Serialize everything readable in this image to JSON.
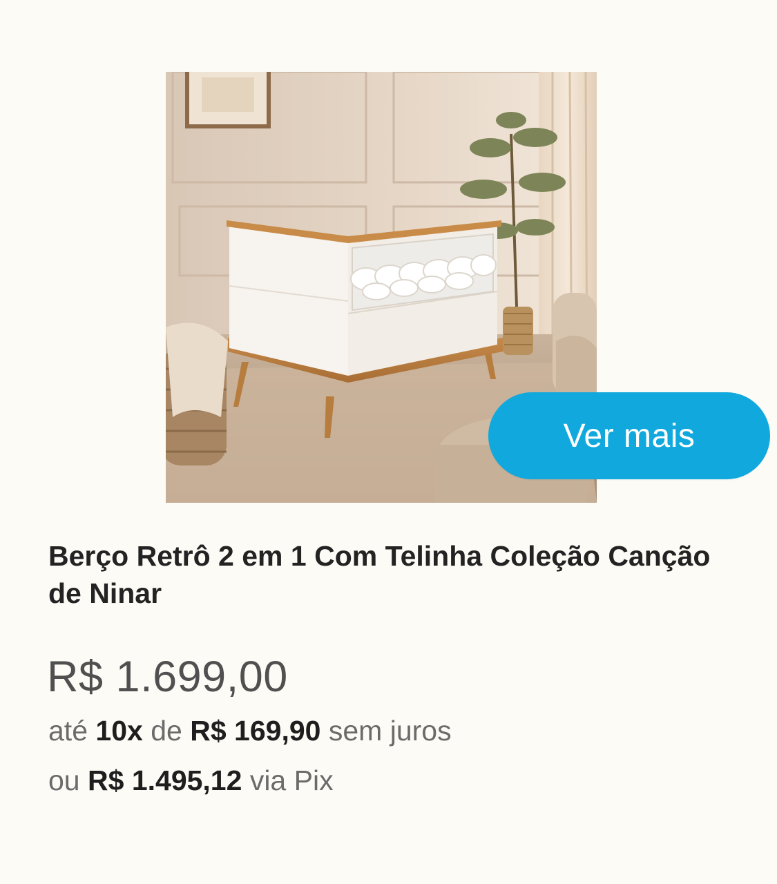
{
  "product": {
    "image_alt": "Berço Retrô 2 em 1 branco com pés de madeira em quarto de bebê",
    "button_label": "Ver mais",
    "title": "Berço Retrô 2 em 1 Com Telinha Coleção Canção de Ninar",
    "price": "R$ 1.699,00",
    "installments": {
      "prefix": "até",
      "count": "10x",
      "of": "de",
      "amount": "R$ 169,90",
      "suffix": "sem juros"
    },
    "pix": {
      "prefix": "ou",
      "amount": "R$ 1.495,12",
      "suffix": "via Pix"
    }
  },
  "colors": {
    "background": "#fdfbf6",
    "button": "#11a9dd",
    "title": "#232323",
    "price": "#505050",
    "muted": "#6b6b6b"
  }
}
